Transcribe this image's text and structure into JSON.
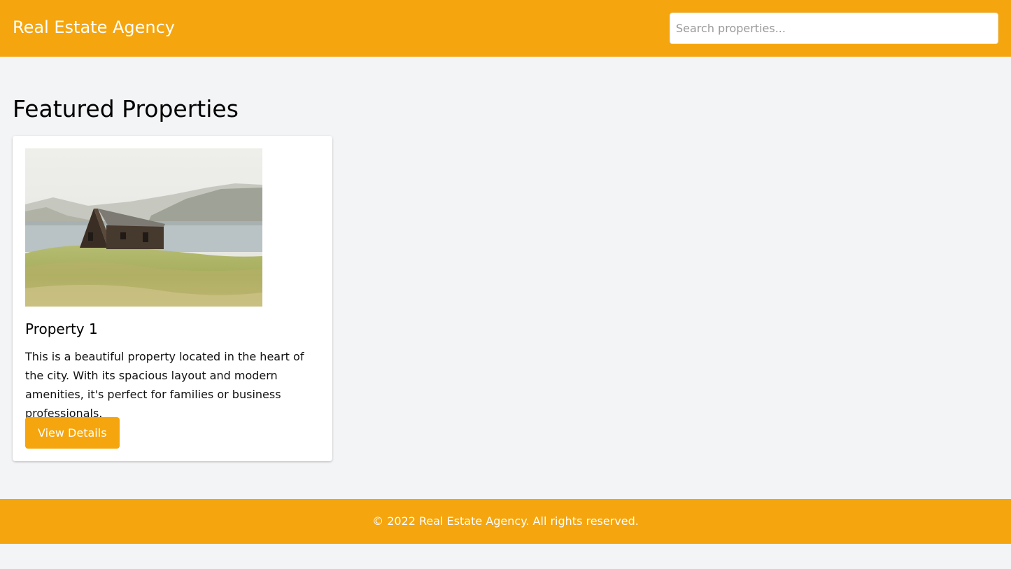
{
  "header": {
    "brand": "Real Estate Agency",
    "search_placeholder": "Search properties..."
  },
  "main": {
    "section_title": "Featured Properties",
    "properties": [
      {
        "title": "Property 1",
        "description": "This is a beautiful property located in the heart of the city. With its spacious layout and modern amenities, it's perfect for families or business professionals.",
        "button_label": "View Details",
        "image_icon": "house-landscape-photo"
      }
    ]
  },
  "footer": {
    "text": "© 2022 Real Estate Agency. All rights reserved."
  },
  "colors": {
    "accent": "#f5a50d",
    "background": "#f3f4f6",
    "card": "#ffffff"
  }
}
